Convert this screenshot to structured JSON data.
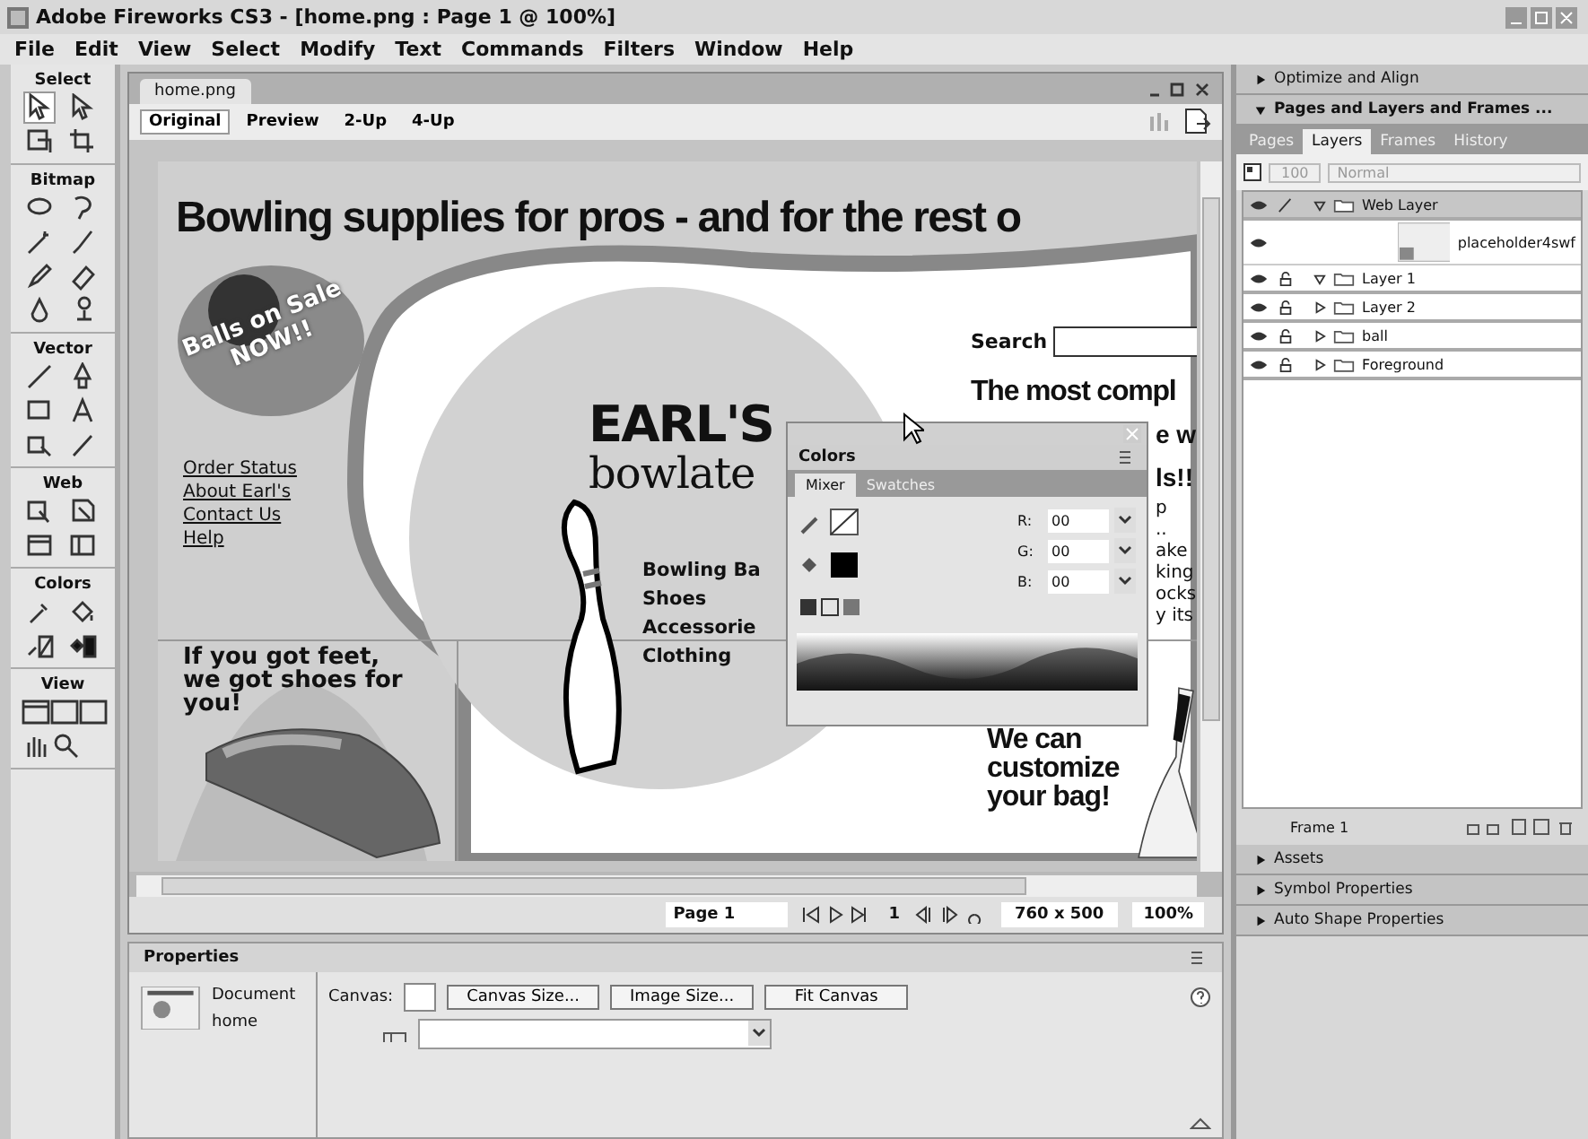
{
  "window": {
    "title": "Adobe Fireworks CS3 - [home.png : Page 1 @ 100%]"
  },
  "menu": [
    "File",
    "Edit",
    "View",
    "Select",
    "Modify",
    "Text",
    "Commands",
    "Filters",
    "Window",
    "Help"
  ],
  "tools": {
    "sections": [
      {
        "label": "Select"
      },
      {
        "label": "Bitmap"
      },
      {
        "label": "Vector"
      },
      {
        "label": "Web"
      },
      {
        "label": "Colors"
      },
      {
        "label": "View"
      }
    ]
  },
  "document": {
    "tab": "home.png",
    "views": [
      {
        "label": "Original",
        "selected": true
      },
      {
        "label": "Preview",
        "selected": false
      },
      {
        "label": "2-Up",
        "selected": false
      },
      {
        "label": "4-Up",
        "selected": false
      }
    ],
    "canvas": {
      "headline": "Bowling supplies for  pros - and for the rest o",
      "sale_badge": [
        "Balls on Sale",
        "NOW!!"
      ],
      "nav_links": [
        "Order Status",
        "About Earl's",
        "Contact Us",
        "Help"
      ],
      "logo": [
        "EARL'S",
        "bowlate"
      ],
      "search_label": "Search",
      "tagline": "The most compl",
      "tagline_fragments": [
        "e w",
        "ls!!",
        "p",
        "..",
        "ake",
        "king",
        "ocks",
        "y its"
      ],
      "categories": [
        "Bowling Ba",
        "Shoes",
        "Accessorie",
        "Clothing"
      ],
      "promo": "If you got feet, we got shoes for you!",
      "bag_promo": "We can customize your bag!"
    },
    "status": {
      "page": "Page 1",
      "frame": "1",
      "size": "760 x 500",
      "zoom": "100%"
    }
  },
  "colors_panel": {
    "title": "Colors",
    "tabs": [
      {
        "label": "Mixer",
        "selected": true
      },
      {
        "label": "Swatches",
        "selected": false
      }
    ],
    "channels": [
      {
        "label": "R:",
        "value": "00"
      },
      {
        "label": "G:",
        "value": "00"
      },
      {
        "label": "B:",
        "value": "00"
      }
    ]
  },
  "properties": {
    "title": "Properties",
    "doc_type": "Document",
    "doc_name": "home",
    "canvas_label": "Canvas:",
    "buttons": [
      "Canvas Size...",
      "Image Size...",
      "Fit Canvas"
    ]
  },
  "right_panel": {
    "collapsed_top": "Optimize and Align",
    "panel_title": "Pages and Layers and Frames ...",
    "tabs": [
      {
        "label": "Pages",
        "selected": false
      },
      {
        "label": "Layers",
        "selected": true
      },
      {
        "label": "Frames",
        "selected": false
      },
      {
        "label": "History",
        "selected": false
      }
    ],
    "opacity": "100",
    "blend": "Normal",
    "layers": [
      {
        "name": "Web Layer",
        "expanded": true,
        "selected": true,
        "kind": "folder",
        "children": [
          {
            "name": "placeholder4swf",
            "kind": "object",
            "selected": false
          }
        ]
      },
      {
        "name": "Layer 1",
        "expanded": true,
        "selected": false,
        "kind": "folder"
      },
      {
        "name": "Layer 2",
        "expanded": false,
        "selected": false,
        "kind": "folder"
      },
      {
        "name": "ball",
        "expanded": false,
        "selected": false,
        "kind": "folder"
      },
      {
        "name": "Foreground",
        "expanded": false,
        "selected": false,
        "kind": "folder"
      }
    ],
    "frame": "Frame 1",
    "collapsed_panels": [
      "Assets",
      "Symbol Properties",
      "Auto Shape Properties"
    ]
  }
}
